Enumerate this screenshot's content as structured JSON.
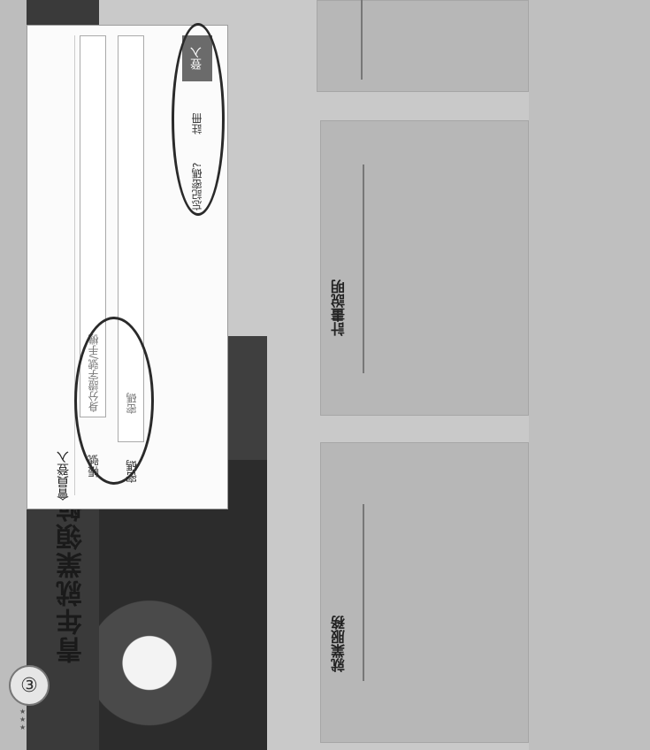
{
  "site": {
    "title": "青年就業領航",
    "logo_icon": "logo-emblem"
  },
  "login_modal": {
    "title": "會員登入",
    "account_label": "帳號",
    "account_placeholder": "身分證字號/手機",
    "password_label": "密碼",
    "password_placeholder": "密碼",
    "login_button": "登入",
    "register_link": "註冊",
    "forgot_link": "忘記密碼?"
  },
  "cards": [
    {
      "title": "計畫說明",
      "body": ""
    },
    {
      "title": "就業服務",
      "body": ""
    }
  ],
  "colors": {
    "accent": "#6b6b6b",
    "header": "#3a3a3a"
  }
}
